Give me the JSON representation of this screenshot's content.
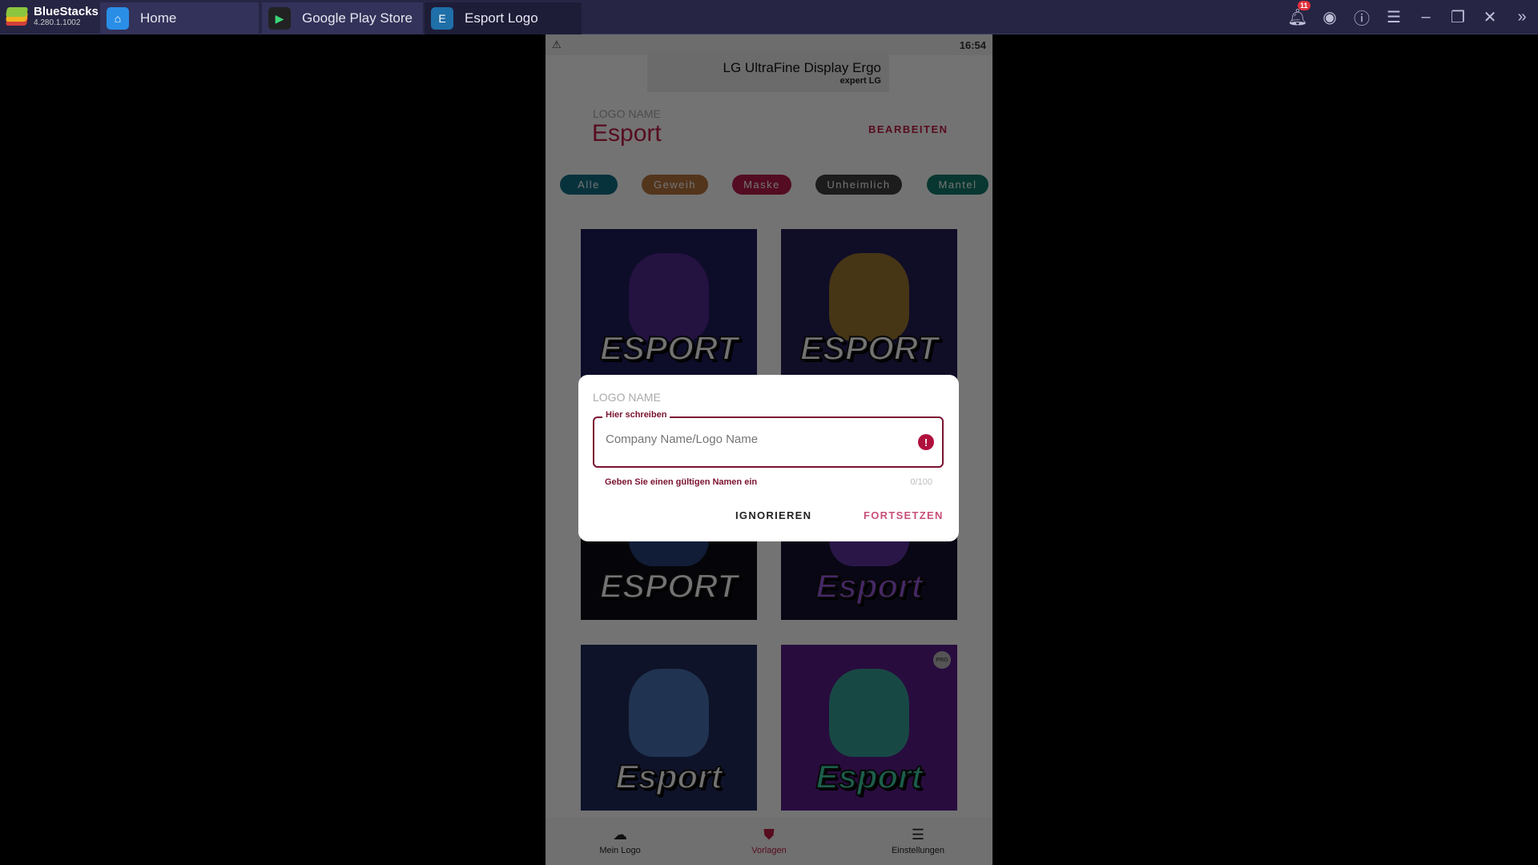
{
  "titlebar": {
    "brand": "BlueStacks",
    "version": "4.280.1.1002",
    "tabs": [
      {
        "label": "Home",
        "icon": "home-icon"
      },
      {
        "label": "Google Play Store",
        "icon": "play-store-icon"
      },
      {
        "label": "Esport Logo",
        "icon": "app-icon"
      }
    ],
    "notification_count": "11"
  },
  "phone": {
    "status_time": "16:54",
    "ad": {
      "line1": "LG UltraFine Display Ergo",
      "line2": "expert LG"
    },
    "logo_name_label": "LOGO NAME",
    "logo_name": "Esport",
    "edit_label": "BEARBEITEN",
    "chips": [
      {
        "label": "Alle",
        "color": "#0f6f86"
      },
      {
        "label": "Geweih",
        "color": "#b9753f"
      },
      {
        "label": "Maske",
        "color": "#b81a4a"
      },
      {
        "label": "Unheimlich",
        "color": "#3f3f3f"
      },
      {
        "label": "Mantel",
        "color": "#0f7a6a"
      }
    ],
    "tiles": [
      {
        "word": "ESPORT"
      },
      {
        "word": "ESPORT"
      },
      {
        "word": "ESPORT"
      },
      {
        "word": "Esport"
      },
      {
        "word": "Esport"
      },
      {
        "word": "Esport",
        "badge": "PRO"
      }
    ],
    "nav": [
      {
        "label": "Mein Logo",
        "icon": "cloud-download-icon"
      },
      {
        "label": "Vorlagen",
        "icon": "shield-icon"
      },
      {
        "label": "Einstellungen",
        "icon": "settings-lines-icon"
      }
    ]
  },
  "dialog": {
    "title": "LOGO NAME",
    "field_label": "Hier schreiben",
    "placeholder": "Company Name/Logo Name",
    "error": "Geben Sie einen gültigen Namen ein",
    "counter": "0/100",
    "ignore": "IGNORIEREN",
    "continue": "FORTSETZEN"
  },
  "colors": {
    "accent": "#c21a45",
    "titlebar": "#262544"
  }
}
